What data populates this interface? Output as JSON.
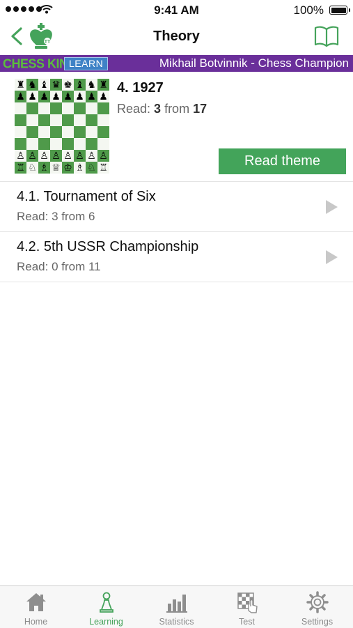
{
  "status_bar": {
    "time": "9:41 AM",
    "battery": "100%"
  },
  "nav": {
    "title": "Theory"
  },
  "banner": {
    "brand": "CHESS KING",
    "learn_badge": "LEARN",
    "course": "Mikhail Botvinnik - Chess Champion"
  },
  "theme": {
    "title": "4. 1927",
    "read_prefix": "Read: ",
    "read_count": "3",
    "read_mid": " from ",
    "read_total": "17",
    "button": "Read theme",
    "board": [
      [
        "♜",
        "♞",
        "♝",
        "♛",
        "♚",
        "♝",
        "♞",
        "♜"
      ],
      [
        "♟",
        "♟",
        "♟",
        "♟",
        "♟",
        "♟",
        "♟",
        "♟"
      ],
      [
        "",
        "",
        "",
        "",
        "",
        "",
        "",
        ""
      ],
      [
        "",
        "",
        "",
        "",
        "",
        "",
        "",
        ""
      ],
      [
        "",
        "",
        "",
        "",
        "",
        "",
        "",
        ""
      ],
      [
        "",
        "",
        "",
        "",
        "",
        "",
        "",
        ""
      ],
      [
        "♙",
        "♙",
        "♙",
        "♙",
        "♙",
        "♙",
        "♙",
        "♙"
      ],
      [
        "♖",
        "♘",
        "♗",
        "♕",
        "♔",
        "♗",
        "♘",
        "♖"
      ]
    ]
  },
  "chapters": [
    {
      "title": "4.1. Tournament of Six",
      "progress": "Read: 3 from 6"
    },
    {
      "title": "4.2. 5th USSR Championship",
      "progress": "Read: 0 from 11"
    }
  ],
  "tabs": [
    {
      "label": "Home",
      "icon": "home-icon"
    },
    {
      "label": "Learning",
      "icon": "pawn-icon"
    },
    {
      "label": "Statistics",
      "icon": "bar-chart-icon"
    },
    {
      "label": "Test",
      "icon": "chessboard-hand-icon"
    },
    {
      "label": "Settings",
      "icon": "gear-icon"
    }
  ],
  "colors": {
    "accent": "#43a45a",
    "banner": "#6a2f9a",
    "brand_green": "#5bbf3c",
    "learn_blue": "#3e82c6"
  }
}
